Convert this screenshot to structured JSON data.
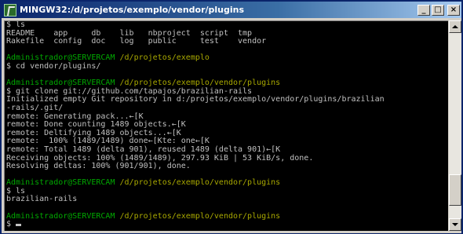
{
  "window": {
    "title": "MINGW32:/d/projetos/exemplo/vendor/plugins",
    "minimize_glyph": "_",
    "maximize_glyph": "□",
    "close_glyph": "×"
  },
  "console": {
    "lines": [
      {
        "type": "text",
        "text": "$ ls"
      },
      {
        "type": "text",
        "text": "README    app     db    lib   nbproject  script  tmp"
      },
      {
        "type": "text",
        "text": "Rakefile  config  doc   log   public     test    vendor"
      },
      {
        "type": "text",
        "text": ""
      },
      {
        "type": "prompt",
        "user": "Administrador@SERVERCAM",
        "path": " /d/projetos/exemplo"
      },
      {
        "type": "text",
        "text": "$ cd vendor/plugins/"
      },
      {
        "type": "text",
        "text": ""
      },
      {
        "type": "prompt",
        "user": "Administrador@SERVERCAM",
        "path": " /d/projetos/exemplo/vendor/plugins"
      },
      {
        "type": "text",
        "text": "$ git clone git://github.com/tapajos/brazilian-rails"
      },
      {
        "type": "text",
        "text": "Initialized empty Git repository in d:/projetos/exemplo/vendor/plugins/brazilian"
      },
      {
        "type": "text",
        "text": "-rails/.git/"
      },
      {
        "type": "text",
        "text": "remote: Generating pack...←[K"
      },
      {
        "type": "text",
        "text": "remote: Done counting 1489 objects.←[K"
      },
      {
        "type": "text",
        "text": "remote: Deltifying 1489 objects...←[K"
      },
      {
        "type": "text",
        "text": "remote:  100% (1489/1489) done←[Kte: one←[K"
      },
      {
        "type": "text",
        "text": "remote: Total 1489 (delta 901), reused 1489 (delta 901)←[K"
      },
      {
        "type": "text",
        "text": "Receiving objects: 100% (1489/1489), 297.93 KiB | 53 KiB/s, done."
      },
      {
        "type": "text",
        "text": "Resolving deltas: 100% (901/901), done."
      },
      {
        "type": "text",
        "text": ""
      },
      {
        "type": "prompt",
        "user": "Administrador@SERVERCAM",
        "path": " /d/projetos/exemplo/vendor/plugins"
      },
      {
        "type": "text",
        "text": "$ ls"
      },
      {
        "type": "text",
        "text": "brazilian-rails"
      },
      {
        "type": "text",
        "text": ""
      },
      {
        "type": "prompt",
        "user": "Administrador@SERVERCAM",
        "path": " /d/projetos/exemplo/vendor/plugins"
      },
      {
        "type": "input",
        "text": "$ "
      }
    ]
  },
  "colors": {
    "console_bg": "#000000",
    "console_text": "#c0c0c0",
    "prompt_user": "#00a800",
    "prompt_path": "#a8a800",
    "titlebar": "#0a246a"
  }
}
